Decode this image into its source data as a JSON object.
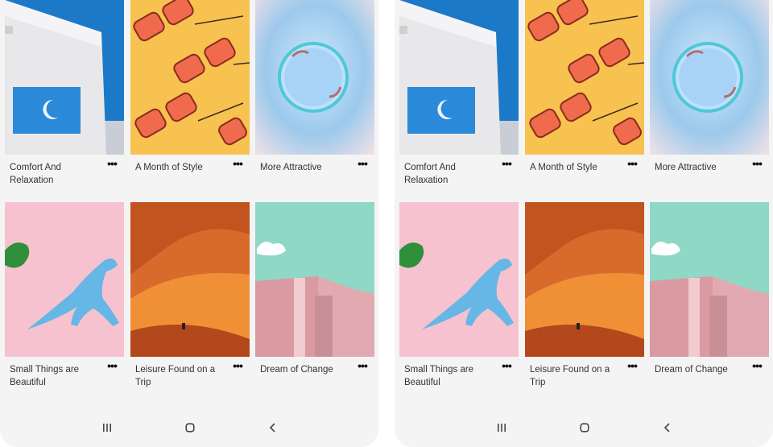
{
  "screens": [
    {
      "tiles": [
        {
          "title": "Comfort And Relaxation",
          "image": "white-building-blue-sky-moon"
        },
        {
          "title": "A Month of Style",
          "image": "red-sunglasses-yellow-background"
        },
        {
          "title": "More Attractive",
          "image": "blue-bubble-sky"
        },
        {
          "title": "Small Things are Beautiful",
          "image": "toy-dinosaurs-pink-background"
        },
        {
          "title": "Leisure Found on a Trip",
          "image": "orange-sand-dunes"
        },
        {
          "title": "Dream of Change",
          "image": "pink-building-mint-sky"
        }
      ]
    },
    {
      "tiles": [
        {
          "title": "Comfort And Relaxation",
          "image": "white-building-blue-sky-moon"
        },
        {
          "title": "A Month of Style",
          "image": "red-sunglasses-yellow-background"
        },
        {
          "title": "More Attractive",
          "image": "blue-bubble-sky"
        },
        {
          "title": "Small Things are Beautiful",
          "image": "toy-dinosaurs-pink-background"
        },
        {
          "title": "Leisure Found on a Trip",
          "image": "orange-sand-dunes"
        },
        {
          "title": "Dream of Change",
          "image": "pink-building-mint-sky"
        }
      ]
    }
  ],
  "more_icon": "more-dots-icon",
  "navigation": [
    "recents-icon",
    "home-icon",
    "back-icon"
  ]
}
